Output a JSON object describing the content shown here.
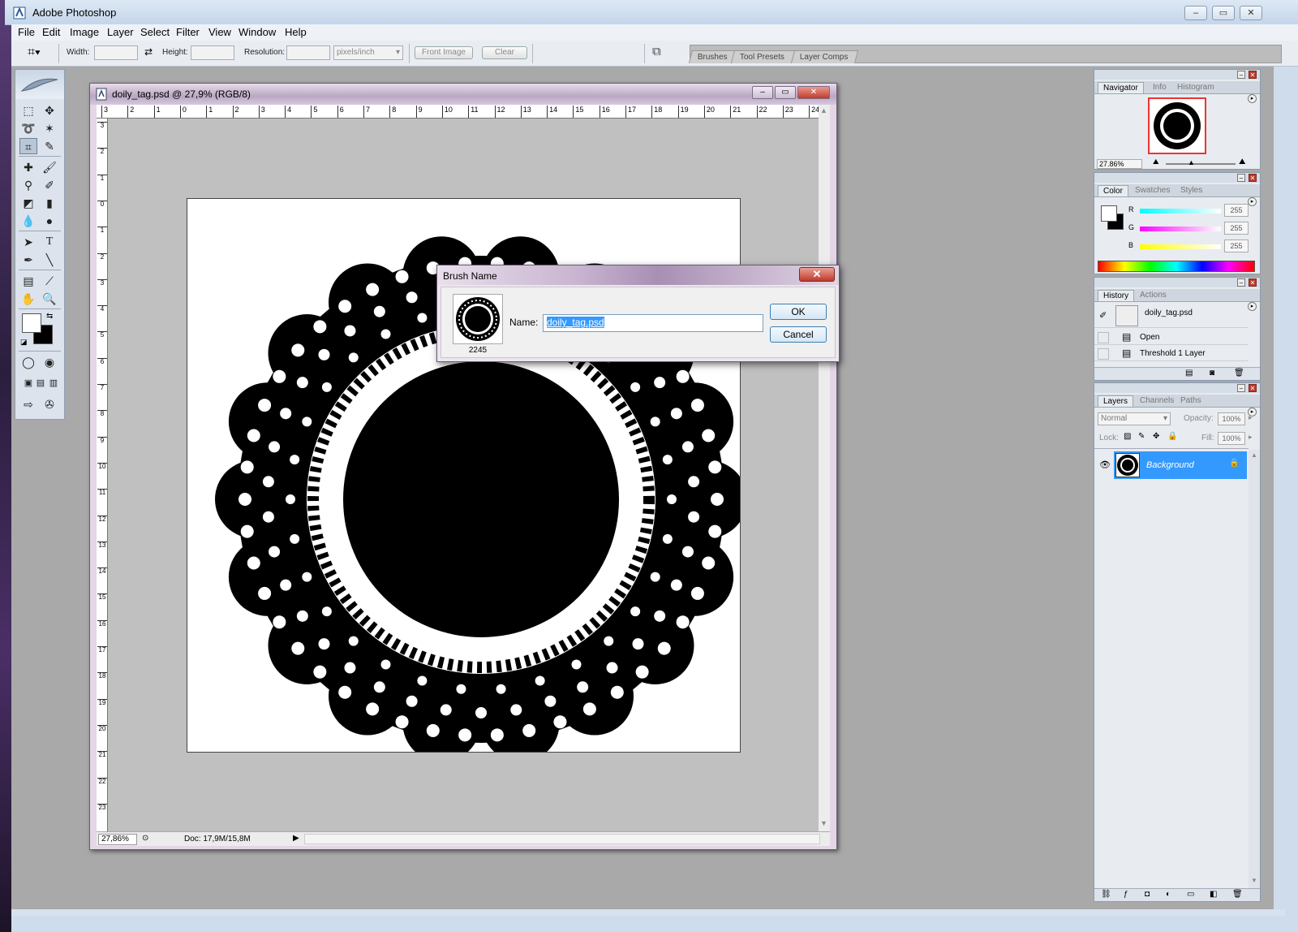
{
  "app": {
    "title": "Adobe Photoshop",
    "window_buttons": [
      "–",
      "▭",
      "✕"
    ]
  },
  "menu": [
    "File",
    "Edit",
    "Image",
    "Layer",
    "Select",
    "Filter",
    "View",
    "Window",
    "Help"
  ],
  "options_bar": {
    "width_label": "Width:",
    "height_label": "Height:",
    "resolution_label": "Resolution:",
    "resolution_unit": "pixels/inch",
    "front_image_button": "Front Image",
    "clear_button": "Clear"
  },
  "palette_well": {
    "tabs": [
      "Brushes",
      "Tool Presets",
      "Layer Comps"
    ]
  },
  "document": {
    "title": "doily_tag.psd @ 27,9% (RGB/8)",
    "ruler_top": [
      "3",
      "2",
      "1",
      "0",
      "1",
      "2",
      "3",
      "4",
      "5",
      "6",
      "7",
      "8",
      "9",
      "10",
      "11",
      "12",
      "13",
      "14",
      "15",
      "16",
      "17",
      "18",
      "19",
      "20",
      "21",
      "22",
      "23",
      "24"
    ],
    "ruler_left": [
      "3",
      "2",
      "1",
      "0",
      "1",
      "2",
      "3",
      "4",
      "5",
      "6",
      "7",
      "8",
      "9",
      "10",
      "11",
      "12",
      "13",
      "14",
      "15",
      "16",
      "17",
      "18",
      "19",
      "20",
      "21",
      "22",
      "23"
    ],
    "zoom": "27,86%",
    "doc_size": "Doc: 17,9M/15,8M"
  },
  "dialog": {
    "title": "Brush Name",
    "brush_size": "2245",
    "name_label": "Name:",
    "name_value": "doily_tag.psd",
    "ok_button": "OK",
    "cancel_button": "Cancel"
  },
  "navigator_panel": {
    "tabs": [
      "Navigator",
      "Info",
      "Histogram"
    ],
    "zoom": "27.86%"
  },
  "color_panel": {
    "tabs": [
      "Color",
      "Swatches",
      "Styles"
    ],
    "channels": [
      {
        "label": "R",
        "value": "255",
        "color": "#00ffff"
      },
      {
        "label": "G",
        "value": "255",
        "color": "#ff00ff"
      },
      {
        "label": "B",
        "value": "255",
        "color": "#ffff00"
      }
    ]
  },
  "history_panel": {
    "tabs": [
      "History",
      "Actions"
    ],
    "snapshot": "doily_tag.psd",
    "states": [
      "Open",
      "Threshold 1 Layer"
    ]
  },
  "layers_panel": {
    "tabs": [
      "Layers",
      "Channels",
      "Paths"
    ],
    "blend_mode": "Normal",
    "opacity_label": "Opacity:",
    "opacity_value": "100%",
    "lock_label": "Lock:",
    "fill_label": "Fill:",
    "fill_value": "100%",
    "layer_name": "Background",
    "selected_color": "#3399ff"
  }
}
